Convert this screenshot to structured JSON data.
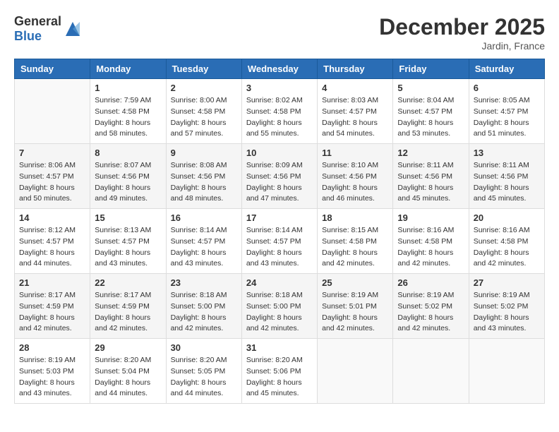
{
  "header": {
    "logo_general": "General",
    "logo_blue": "Blue",
    "month_year": "December 2025",
    "location": "Jardin, France"
  },
  "weekdays": [
    "Sunday",
    "Monday",
    "Tuesday",
    "Wednesday",
    "Thursday",
    "Friday",
    "Saturday"
  ],
  "weeks": [
    [
      {
        "day": "",
        "info": ""
      },
      {
        "day": "1",
        "info": "Sunrise: 7:59 AM\nSunset: 4:58 PM\nDaylight: 8 hours\nand 58 minutes."
      },
      {
        "day": "2",
        "info": "Sunrise: 8:00 AM\nSunset: 4:58 PM\nDaylight: 8 hours\nand 57 minutes."
      },
      {
        "day": "3",
        "info": "Sunrise: 8:02 AM\nSunset: 4:58 PM\nDaylight: 8 hours\nand 55 minutes."
      },
      {
        "day": "4",
        "info": "Sunrise: 8:03 AM\nSunset: 4:57 PM\nDaylight: 8 hours\nand 54 minutes."
      },
      {
        "day": "5",
        "info": "Sunrise: 8:04 AM\nSunset: 4:57 PM\nDaylight: 8 hours\nand 53 minutes."
      },
      {
        "day": "6",
        "info": "Sunrise: 8:05 AM\nSunset: 4:57 PM\nDaylight: 8 hours\nand 51 minutes."
      }
    ],
    [
      {
        "day": "7",
        "info": "Sunrise: 8:06 AM\nSunset: 4:57 PM\nDaylight: 8 hours\nand 50 minutes."
      },
      {
        "day": "8",
        "info": "Sunrise: 8:07 AM\nSunset: 4:56 PM\nDaylight: 8 hours\nand 49 minutes."
      },
      {
        "day": "9",
        "info": "Sunrise: 8:08 AM\nSunset: 4:56 PM\nDaylight: 8 hours\nand 48 minutes."
      },
      {
        "day": "10",
        "info": "Sunrise: 8:09 AM\nSunset: 4:56 PM\nDaylight: 8 hours\nand 47 minutes."
      },
      {
        "day": "11",
        "info": "Sunrise: 8:10 AM\nSunset: 4:56 PM\nDaylight: 8 hours\nand 46 minutes."
      },
      {
        "day": "12",
        "info": "Sunrise: 8:11 AM\nSunset: 4:56 PM\nDaylight: 8 hours\nand 45 minutes."
      },
      {
        "day": "13",
        "info": "Sunrise: 8:11 AM\nSunset: 4:56 PM\nDaylight: 8 hours\nand 45 minutes."
      }
    ],
    [
      {
        "day": "14",
        "info": "Sunrise: 8:12 AM\nSunset: 4:57 PM\nDaylight: 8 hours\nand 44 minutes."
      },
      {
        "day": "15",
        "info": "Sunrise: 8:13 AM\nSunset: 4:57 PM\nDaylight: 8 hours\nand 43 minutes."
      },
      {
        "day": "16",
        "info": "Sunrise: 8:14 AM\nSunset: 4:57 PM\nDaylight: 8 hours\nand 43 minutes."
      },
      {
        "day": "17",
        "info": "Sunrise: 8:14 AM\nSunset: 4:57 PM\nDaylight: 8 hours\nand 43 minutes."
      },
      {
        "day": "18",
        "info": "Sunrise: 8:15 AM\nSunset: 4:58 PM\nDaylight: 8 hours\nand 42 minutes."
      },
      {
        "day": "19",
        "info": "Sunrise: 8:16 AM\nSunset: 4:58 PM\nDaylight: 8 hours\nand 42 minutes."
      },
      {
        "day": "20",
        "info": "Sunrise: 8:16 AM\nSunset: 4:58 PM\nDaylight: 8 hours\nand 42 minutes."
      }
    ],
    [
      {
        "day": "21",
        "info": "Sunrise: 8:17 AM\nSunset: 4:59 PM\nDaylight: 8 hours\nand 42 minutes."
      },
      {
        "day": "22",
        "info": "Sunrise: 8:17 AM\nSunset: 4:59 PM\nDaylight: 8 hours\nand 42 minutes."
      },
      {
        "day": "23",
        "info": "Sunrise: 8:18 AM\nSunset: 5:00 PM\nDaylight: 8 hours\nand 42 minutes."
      },
      {
        "day": "24",
        "info": "Sunrise: 8:18 AM\nSunset: 5:00 PM\nDaylight: 8 hours\nand 42 minutes."
      },
      {
        "day": "25",
        "info": "Sunrise: 8:19 AM\nSunset: 5:01 PM\nDaylight: 8 hours\nand 42 minutes."
      },
      {
        "day": "26",
        "info": "Sunrise: 8:19 AM\nSunset: 5:02 PM\nDaylight: 8 hours\nand 42 minutes."
      },
      {
        "day": "27",
        "info": "Sunrise: 8:19 AM\nSunset: 5:02 PM\nDaylight: 8 hours\nand 43 minutes."
      }
    ],
    [
      {
        "day": "28",
        "info": "Sunrise: 8:19 AM\nSunset: 5:03 PM\nDaylight: 8 hours\nand 43 minutes."
      },
      {
        "day": "29",
        "info": "Sunrise: 8:20 AM\nSunset: 5:04 PM\nDaylight: 8 hours\nand 44 minutes."
      },
      {
        "day": "30",
        "info": "Sunrise: 8:20 AM\nSunset: 5:05 PM\nDaylight: 8 hours\nand 44 minutes."
      },
      {
        "day": "31",
        "info": "Sunrise: 8:20 AM\nSunset: 5:06 PM\nDaylight: 8 hours\nand 45 minutes."
      },
      {
        "day": "",
        "info": ""
      },
      {
        "day": "",
        "info": ""
      },
      {
        "day": "",
        "info": ""
      }
    ]
  ]
}
